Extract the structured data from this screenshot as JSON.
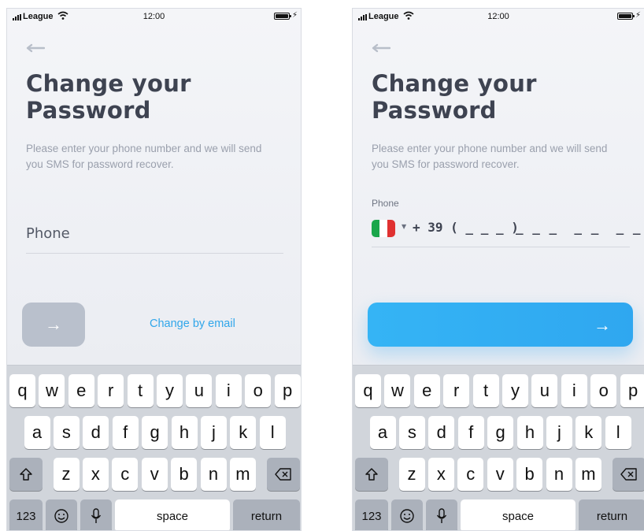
{
  "status_bar": {
    "carrier": "League",
    "time": "12:00"
  },
  "left_screen": {
    "title_line1": "Change your",
    "title_line2": "Password",
    "subtitle": "Please enter your phone number and we will send you SMS for password recover.",
    "phone_placeholder": "Phone",
    "next_button_label": "→",
    "alt_link": "Change by email"
  },
  "right_screen": {
    "title_line1": "Change your",
    "title_line2": "Password",
    "subtitle": "Please enter your phone number and we will send you SMS for password recover.",
    "phone_label": "Phone",
    "country_code": "+ 39 ( _ _ _ )",
    "number_mask": "_ _ _  _ _  _ _",
    "next_button_label": "→"
  },
  "keyboard": {
    "row1": [
      "q",
      "w",
      "e",
      "r",
      "t",
      "y",
      "u",
      "i",
      "o",
      "p"
    ],
    "row2": [
      "a",
      "s",
      "d",
      "f",
      "g",
      "h",
      "j",
      "k",
      "l"
    ],
    "row3": [
      "z",
      "x",
      "c",
      "v",
      "b",
      "n",
      "m"
    ],
    "numbers_key": "123",
    "space_key": "space",
    "return_key": "return",
    "shift_icon": "shift-icon",
    "delete_icon": "delete-icon",
    "emoji_icon": "emoji-icon",
    "mic_icon": "microphone-icon"
  },
  "colors": {
    "accent": "#2fa6ea",
    "button_disabled": "#b9c0cc",
    "flag_green": "#1aa64b",
    "flag_white": "#ffffff",
    "flag_red": "#e03131"
  }
}
